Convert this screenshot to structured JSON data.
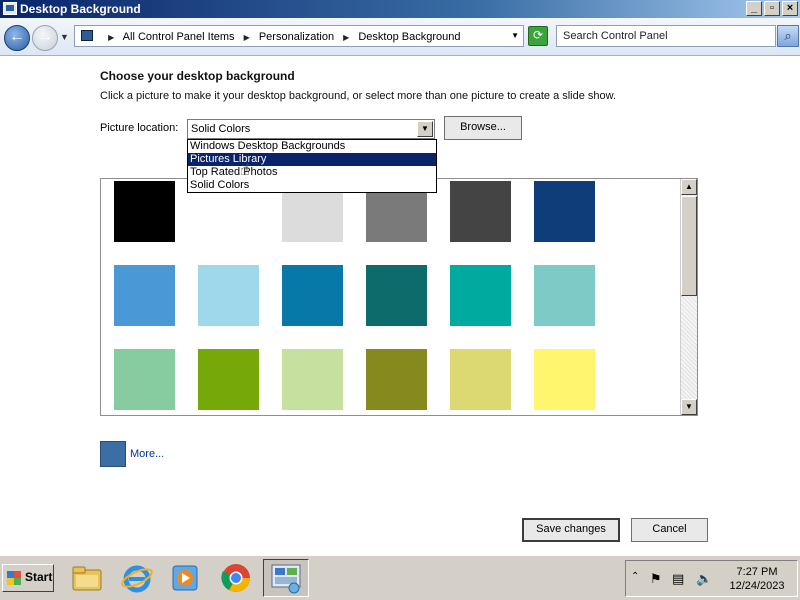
{
  "window": {
    "title": "Desktop Background",
    "minimize": "_",
    "maximize": "▫",
    "close": "×"
  },
  "address": {
    "crumbs": [
      "All Control Panel Items",
      "Personalization",
      "Desktop Background"
    ],
    "search_placeholder": "Search Control Panel"
  },
  "content": {
    "heading": "Choose your desktop background",
    "subtext": "Click a picture to make it your desktop background, or select more than one picture to create a slide show.",
    "location_label": "Picture location:",
    "location_value": "Solid Colors",
    "browse_label": "Browse...",
    "dropdown_options": [
      {
        "label": "Windows Desktop Backgrounds",
        "selected": false
      },
      {
        "label": "Pictures Library",
        "selected": true
      },
      {
        "label": "Top Rated Photos",
        "selected": false
      },
      {
        "label": "Solid Colors",
        "selected": false
      }
    ],
    "swatches": [
      [
        "#000000",
        "#ffffff",
        "#dcdcdc",
        "#7a7a7a",
        "#444444",
        "#0f3d7a"
      ],
      [
        "#4a98d6",
        "#9fd8ea",
        "#0878a8",
        "#0e6b6b",
        "#00aa9e",
        "#7ecac6"
      ],
      [
        "#86cca0",
        "#76a80a",
        "#c6e0a0",
        "#868a1e",
        "#dcd872",
        "#fff56e"
      ]
    ],
    "more_color": "#3a6ea5",
    "more_label": "More...",
    "save_label": "Save changes",
    "cancel_label": "Cancel"
  },
  "taskbar": {
    "start_label": "Start",
    "time": "7:27 PM",
    "date": "12/24/2023"
  }
}
